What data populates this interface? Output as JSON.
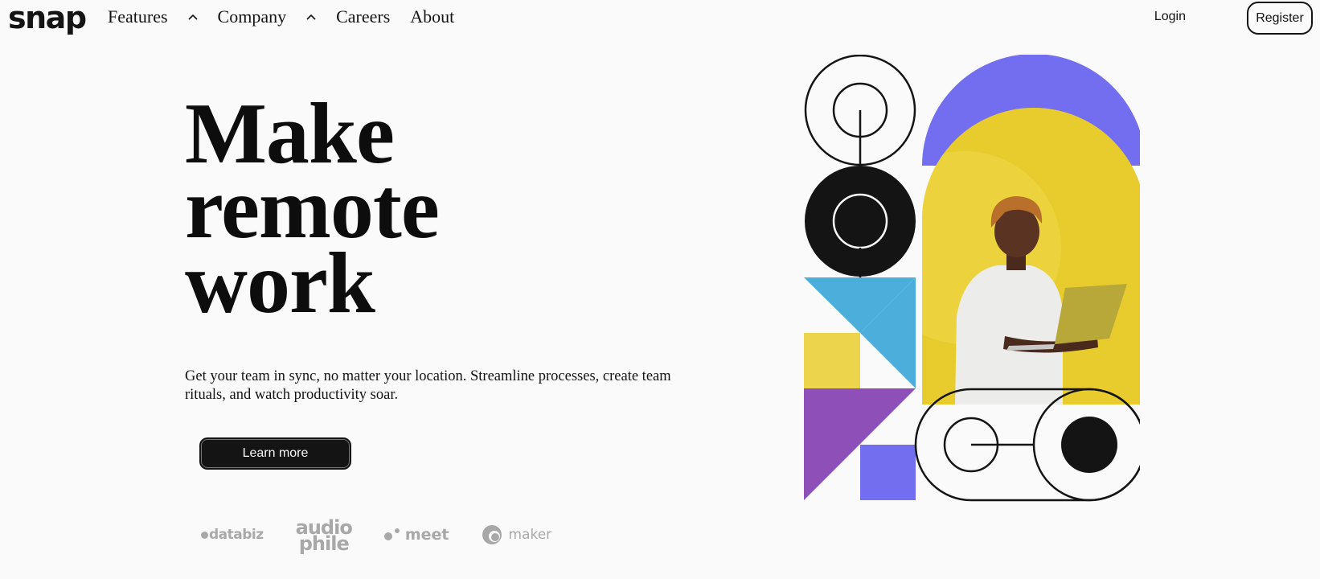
{
  "header": {
    "logo": "snap",
    "nav": [
      {
        "label": "Features",
        "has_dropdown": true
      },
      {
        "label": "Company",
        "has_dropdown": true
      },
      {
        "label": "Careers",
        "has_dropdown": false
      },
      {
        "label": "About",
        "has_dropdown": false
      }
    ],
    "login_label": "Login",
    "register_label": "Register"
  },
  "hero": {
    "headline": [
      "Make",
      "remote",
      "work"
    ],
    "subtext": "Get your team in sync, no matter your location. Streamline processes, create team rituals, and watch productivity soar.",
    "cta_label": "Learn more"
  },
  "clients": {
    "databiz": "databiz",
    "audiophile": [
      "audio",
      "phile"
    ],
    "meet": "meet",
    "maker": "maker"
  },
  "colors": {
    "purple": "#726eef",
    "yellow": "#e8cb2c",
    "blue": "#4cafdb",
    "violet": "#8e4fb9",
    "dark": "#141414",
    "logo_gray": "#a8a8a8"
  }
}
